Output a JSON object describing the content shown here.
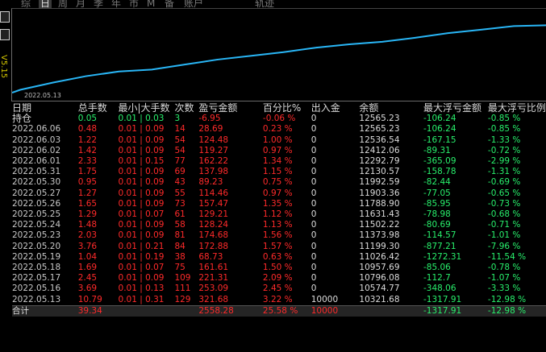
{
  "tabs": [
    "综",
    "日",
    "周",
    "月",
    "季",
    "年",
    "市",
    "M",
    "备",
    "账户",
    "轨迹"
  ],
  "active_tab": "日",
  "side_vertical": "V5.15",
  "chart": {
    "start_date_label": "2022.05.13",
    "line_color": "#29b6f6"
  },
  "chart_data": {
    "type": "line",
    "x": [
      "2022.05.13",
      "2022.05.16",
      "2022.05.17",
      "2022.05.18",
      "2022.05.19",
      "2022.05.20",
      "2022.05.23",
      "2022.05.24",
      "2022.05.25",
      "2022.05.26",
      "2022.05.27",
      "2022.05.30",
      "2022.05.31",
      "2022.06.01",
      "2022.06.02",
      "2022.06.03",
      "2022.06.06"
    ],
    "y": [
      10321.68,
      10574.77,
      10796.08,
      10957.69,
      11026.42,
      11199.3,
      11373.98,
      11502.22,
      11631.43,
      11788.9,
      11903.36,
      11992.59,
      12130.57,
      12292.79,
      12412.06,
      12536.54,
      12565.23
    ],
    "xlabel": "",
    "ylabel": ""
  },
  "headers": [
    "日期",
    "总手数",
    "最小|大手数",
    "次数",
    "盈亏金额",
    "百分比%",
    "出入金",
    "余额",
    "最大浮亏金额",
    "最大浮亏比例"
  ],
  "position_row": {
    "date": "持仓",
    "lots": "0.05",
    "minmax": "0.01 | 0.03",
    "count": "3",
    "pnl": "-6.95",
    "pct": "-0.06 %",
    "inout": "0",
    "balance": "12565.23",
    "maxdd": "-106.24",
    "maxdd_pct": "-0.85 %"
  },
  "rows": [
    {
      "date": "2022.06.06",
      "lots": "0.48",
      "minmax": "0.01 | 0.09",
      "count": "14",
      "pnl": "28.69",
      "pct": "0.23 %",
      "inout": "0",
      "balance": "12565.23",
      "maxdd": "-106.24",
      "maxdd_pct": "-0.85 %"
    },
    {
      "date": "2022.06.03",
      "lots": "1.22",
      "minmax": "0.01 | 0.09",
      "count": "54",
      "pnl": "124.48",
      "pct": "1.00 %",
      "inout": "0",
      "balance": "12536.54",
      "maxdd": "-167.15",
      "maxdd_pct": "-1.33 %"
    },
    {
      "date": "2022.06.02",
      "lots": "1.42",
      "minmax": "0.01 | 0.09",
      "count": "54",
      "pnl": "119.27",
      "pct": "0.97 %",
      "inout": "0",
      "balance": "12412.06",
      "maxdd": "-89.31",
      "maxdd_pct": "-0.72 %"
    },
    {
      "date": "2022.06.01",
      "lots": "2.33",
      "minmax": "0.01 | 0.15",
      "count": "77",
      "pnl": "162.22",
      "pct": "1.34 %",
      "inout": "0",
      "balance": "12292.79",
      "maxdd": "-365.09",
      "maxdd_pct": "-2.99 %"
    },
    {
      "date": "2022.05.31",
      "lots": "1.75",
      "minmax": "0.01 | 0.09",
      "count": "69",
      "pnl": "137.98",
      "pct": "1.15 %",
      "inout": "0",
      "balance": "12130.57",
      "maxdd": "-158.78",
      "maxdd_pct": "-1.31 %"
    },
    {
      "date": "2022.05.30",
      "lots": "0.95",
      "minmax": "0.01 | 0.09",
      "count": "43",
      "pnl": "89.23",
      "pct": "0.75 %",
      "inout": "0",
      "balance": "11992.59",
      "maxdd": "-82.44",
      "maxdd_pct": "-0.69 %"
    },
    {
      "date": "2022.05.27",
      "lots": "1.27",
      "minmax": "0.01 | 0.09",
      "count": "55",
      "pnl": "114.46",
      "pct": "0.97 %",
      "inout": "0",
      "balance": "11903.36",
      "maxdd": "-77.05",
      "maxdd_pct": "-0.65 %"
    },
    {
      "date": "2022.05.26",
      "lots": "1.65",
      "minmax": "0.01 | 0.09",
      "count": "73",
      "pnl": "157.47",
      "pct": "1.35 %",
      "inout": "0",
      "balance": "11788.90",
      "maxdd": "-85.95",
      "maxdd_pct": "-0.73 %"
    },
    {
      "date": "2022.05.25",
      "lots": "1.29",
      "minmax": "0.01 | 0.07",
      "count": "61",
      "pnl": "129.21",
      "pct": "1.12 %",
      "inout": "0",
      "balance": "11631.43",
      "maxdd": "-78.98",
      "maxdd_pct": "-0.68 %"
    },
    {
      "date": "2022.05.24",
      "lots": "1.48",
      "minmax": "0.01 | 0.09",
      "count": "58",
      "pnl": "128.24",
      "pct": "1.13 %",
      "inout": "0",
      "balance": "11502.22",
      "maxdd": "-80.69",
      "maxdd_pct": "-0.71 %"
    },
    {
      "date": "2022.05.23",
      "lots": "2.03",
      "minmax": "0.01 | 0.09",
      "count": "81",
      "pnl": "174.68",
      "pct": "1.56 %",
      "inout": "0",
      "balance": "11373.98",
      "maxdd": "-114.57",
      "maxdd_pct": "-1.01 %"
    },
    {
      "date": "2022.05.20",
      "lots": "3.76",
      "minmax": "0.01 | 0.21",
      "count": "84",
      "pnl": "172.88",
      "pct": "1.57 %",
      "inout": "0",
      "balance": "11199.30",
      "maxdd": "-877.21",
      "maxdd_pct": "-7.96 %"
    },
    {
      "date": "2022.05.19",
      "lots": "1.04",
      "minmax": "0.01 | 0.19",
      "count": "38",
      "pnl": "68.73",
      "pct": "0.63 %",
      "inout": "0",
      "balance": "11026.42",
      "maxdd": "-1272.31",
      "maxdd_pct": "-11.54 %"
    },
    {
      "date": "2022.05.18",
      "lots": "1.69",
      "minmax": "0.01 | 0.07",
      "count": "75",
      "pnl": "161.61",
      "pct": "1.50 %",
      "inout": "0",
      "balance": "10957.69",
      "maxdd": "-85.06",
      "maxdd_pct": "-0.78 %"
    },
    {
      "date": "2022.05.17",
      "lots": "2.45",
      "minmax": "0.01 | 0.09",
      "count": "109",
      "pnl": "221.31",
      "pct": "2.09 %",
      "inout": "0",
      "balance": "10796.08",
      "maxdd": "-112.7",
      "maxdd_pct": "-1.07 %"
    },
    {
      "date": "2022.05.16",
      "lots": "3.69",
      "minmax": "0.01 | 0.13",
      "count": "111",
      "pnl": "253.09",
      "pct": "2.45 %",
      "inout": "0",
      "balance": "10574.77",
      "maxdd": "-348.06",
      "maxdd_pct": "-3.33 %"
    },
    {
      "date": "2022.05.13",
      "lots": "10.79",
      "minmax": "0.01 | 0.31",
      "count": "129",
      "pnl": "321.68",
      "pct": "3.22 %",
      "inout": "10000",
      "balance": "10321.68",
      "maxdd": "-1317.91",
      "maxdd_pct": "-12.98 %"
    }
  ],
  "total_row": {
    "date": "合计",
    "lots": "39.34",
    "minmax": "",
    "count": "",
    "pnl": "2558.28",
    "pct": "25.58 %",
    "inout": "10000",
    "balance": "",
    "maxdd": "-1317.91",
    "maxdd_pct": "-12.98 %"
  }
}
